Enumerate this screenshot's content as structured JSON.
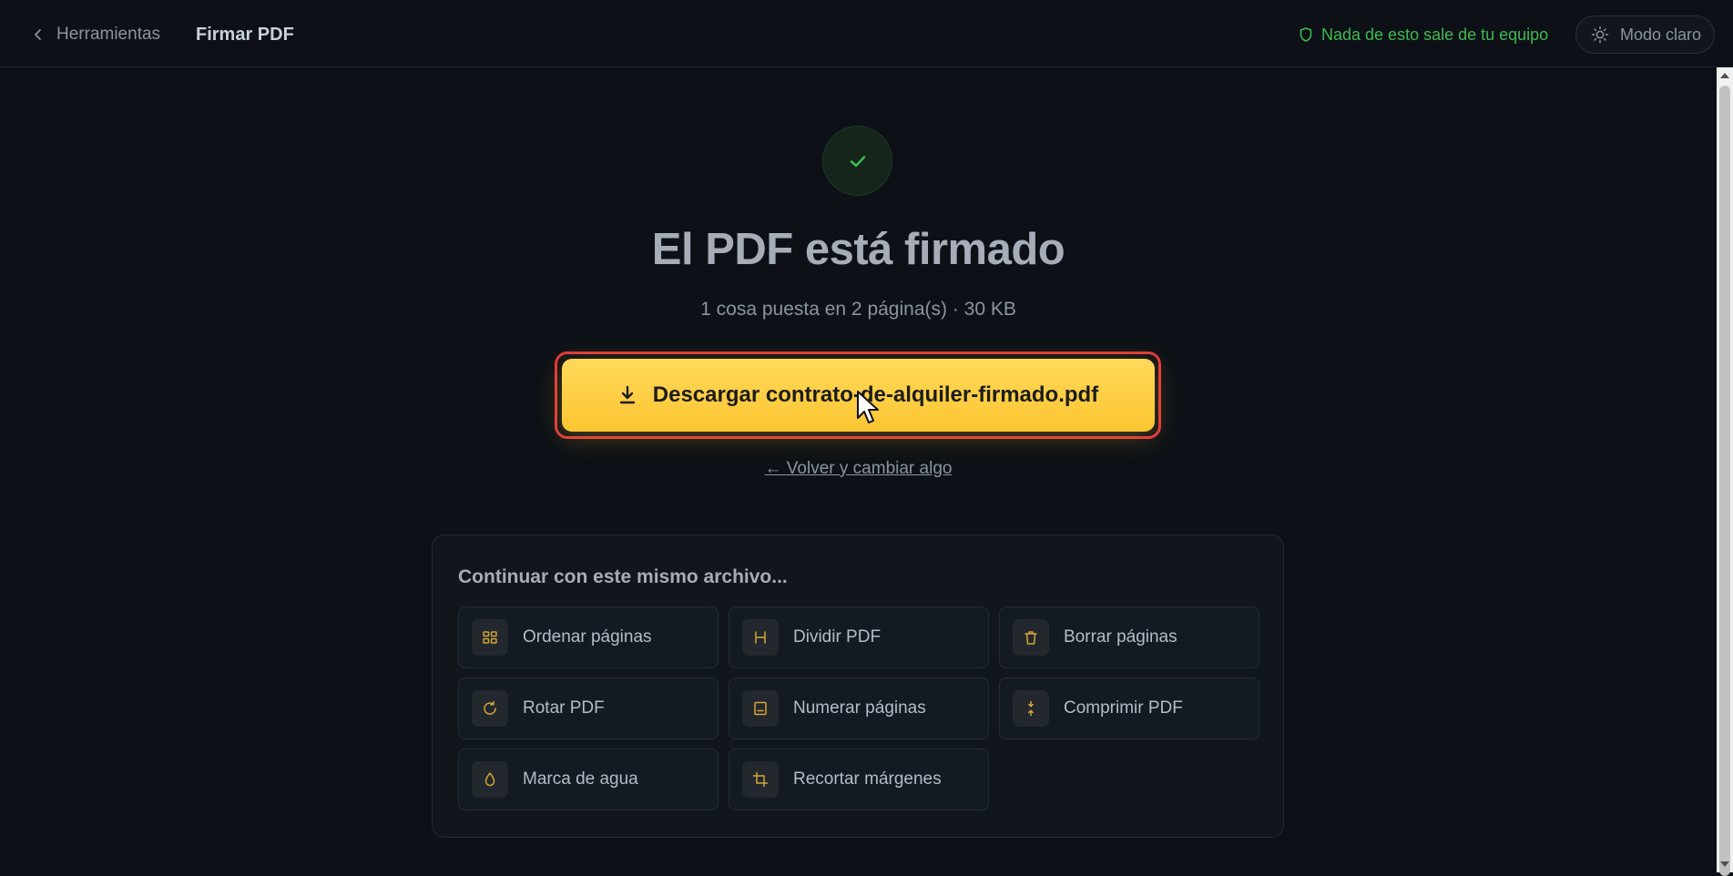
{
  "header": {
    "back_label": "Herramientas",
    "tool_title": "Firmar PDF",
    "privacy_text": "Nada de esto sale de tu equipo",
    "theme_label": "Modo claro"
  },
  "result": {
    "headline": "El PDF está firmado",
    "summary": "1 cosa puesta en 2 página(s) · 30 KB",
    "download_label": "Descargar contrato-de-alquiler-firmado.pdf",
    "back_link": "← Volver y cambiar algo"
  },
  "continue": {
    "title": "Continuar con este mismo archivo...",
    "tools": [
      {
        "label": "Ordenar páginas",
        "icon": "grid-icon"
      },
      {
        "label": "Dividir PDF",
        "icon": "split-icon"
      },
      {
        "label": "Borrar páginas",
        "icon": "trash-icon"
      },
      {
        "label": "Rotar PDF",
        "icon": "rotate-icon"
      },
      {
        "label": "Numerar páginas",
        "icon": "page-number-icon"
      },
      {
        "label": "Comprimir PDF",
        "icon": "compress-icon"
      },
      {
        "label": "Marca de agua",
        "icon": "droplet-icon"
      },
      {
        "label": "Recortar márgenes",
        "icon": "crop-icon"
      }
    ]
  },
  "colors": {
    "background": "#0d1117",
    "accent": "#fcc531",
    "success": "#3fb950",
    "highlight_outline": "#e0373b"
  }
}
